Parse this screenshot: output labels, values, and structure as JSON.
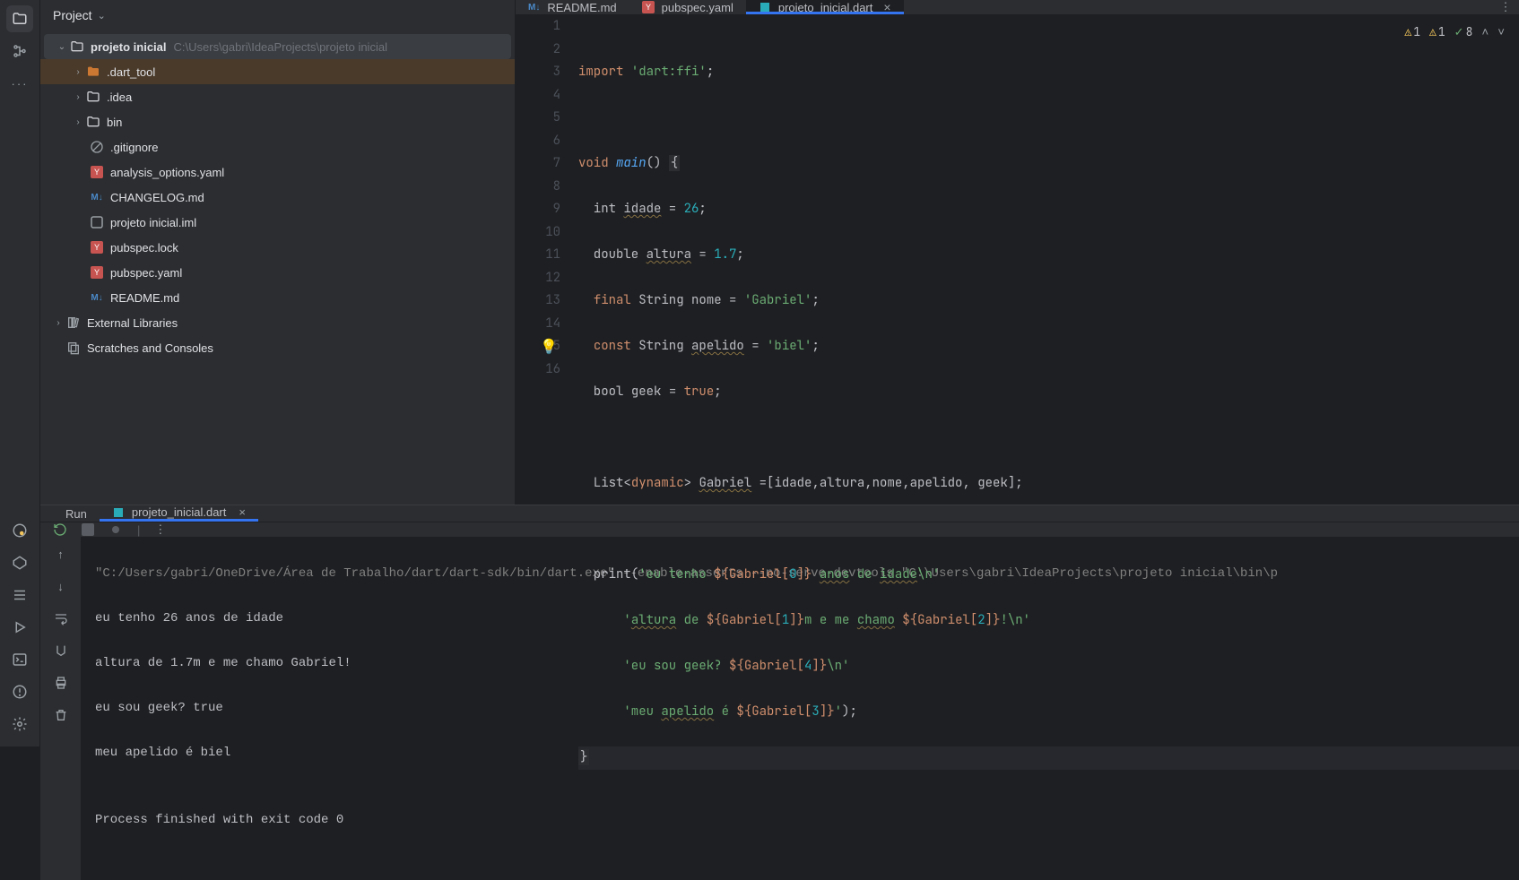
{
  "sidebar": {
    "project_label": "Project"
  },
  "tree": {
    "root_name": "projeto inicial",
    "root_path": "C:\\Users\\gabri\\IdeaProjects\\projeto inicial",
    "items": [
      {
        "name": ".dart_tool",
        "type": "folder"
      },
      {
        "name": ".idea",
        "type": "folder"
      },
      {
        "name": "bin",
        "type": "folder"
      },
      {
        "name": ".gitignore",
        "type": "gitignore"
      },
      {
        "name": "analysis_options.yaml",
        "type": "yaml"
      },
      {
        "name": "CHANGELOG.md",
        "type": "md"
      },
      {
        "name": "projeto inicial.iml",
        "type": "iml"
      },
      {
        "name": "pubspec.lock",
        "type": "yaml"
      },
      {
        "name": "pubspec.yaml",
        "type": "yaml"
      },
      {
        "name": "README.md",
        "type": "md"
      }
    ],
    "external_libs": "External Libraries",
    "scratches": "Scratches and Consoles"
  },
  "tabs": [
    {
      "label": "README.md",
      "type": "md"
    },
    {
      "label": "pubspec.yaml",
      "type": "yaml"
    },
    {
      "label": "projeto_inicial.dart",
      "type": "dart",
      "active": true
    }
  ],
  "inspections": {
    "warn1": "1",
    "warn2": "1",
    "ok": "8"
  },
  "code": {
    "l1a": "import ",
    "l1b": "'dart:ffi'",
    "l1c": ";",
    "l3a": "void ",
    "l3b": "main",
    "l3c": "() ",
    "l3d": "{",
    "l4a": "  int ",
    "l4b": "idade",
    "l4c": " = ",
    "l4d": "26",
    "l4e": ";",
    "l5a": "  double ",
    "l5b": "altura",
    "l5c": " = ",
    "l5d": "1.7",
    "l5e": ";",
    "l6a": "  ",
    "l6b": "final",
    "l6c": " String ",
    "l6d": "nome",
    "l6e": " = ",
    "l6f": "'Gabriel'",
    "l6g": ";",
    "l7a": "  ",
    "l7b": "const",
    "l7c": " String ",
    "l7d": "apelido",
    "l7e": " = ",
    "l7f": "'biel'",
    "l7g": ";",
    "l8a": "  bool ",
    "l8b": "geek",
    "l8c": " = ",
    "l8d": "true",
    "l8e": ";",
    "l10a": "  List<",
    "l10b": "dynamic",
    "l10c": "> ",
    "l10d": "Gabriel",
    "l10e": " =[idade,altura,nome,apelido, geek];",
    "l12a": "  print(",
    "l12b": "'eu tenho ",
    "l12c": "${Gabriel[",
    "l12d": "0",
    "l12e": "]}",
    "l12f": " ",
    "l12g": "anos",
    "l12h": " de ",
    "l12i": "idade",
    "l12j": "\\n'",
    "l13a": "      ",
    "l13b": "'",
    "l13c": "altura",
    "l13d": " de ",
    "l13e": "${Gabriel[",
    "l13f": "1",
    "l13g": "]}",
    "l13h": "m e me ",
    "l13i": "chamo",
    "l13j": " ",
    "l13k": "${Gabriel[",
    "l13l": "2",
    "l13m": "]}",
    "l13n": "!\\n'",
    "l14a": "      ",
    "l14b": "'eu sou geek? ",
    "l14c": "${Gabriel[",
    "l14d": "4",
    "l14e": "]}",
    "l14f": "\\n'",
    "l15a": "      ",
    "l15b": "'meu ",
    "l15c": "apelido",
    "l15d": " é ",
    "l15e": "${Gabriel[",
    "l15f": "3",
    "l15g": "]}",
    "l15h": "'",
    "l15i": ");",
    "l16a": "}"
  },
  "run": {
    "tab_run": "Run",
    "tab_file": "projeto_inicial.dart",
    "cmd": "\"C:/Users/gabri/OneDrive/Área de Trabalho/dart/dart-sdk/bin/dart.exe\" --enable-asserts --no-serve-devtools \"C:\\Users\\gabri\\IdeaProjects\\projeto inicial\\bin\\p",
    "out1": "eu tenho 26 anos de idade",
    "out2": "altura de 1.7m e me chamo Gabriel!",
    "out3": "eu sou geek? true",
    "out4": "meu apelido é biel",
    "exit": "Process finished with exit code 0"
  }
}
